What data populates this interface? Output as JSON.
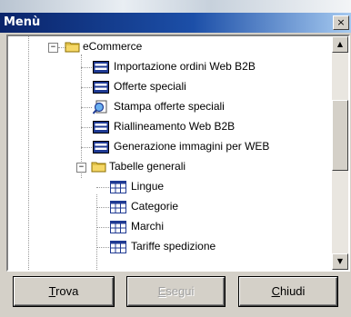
{
  "window": {
    "title": "Menù",
    "close_glyph": "×"
  },
  "tree": [
    {
      "label": "eCommerce",
      "icon": "folder-open-icon",
      "expander": "−"
    },
    {
      "label": "Importazione ordini Web B2B",
      "icon": "form-icon"
    },
    {
      "label": "Offerte speciali",
      "icon": "form-icon"
    },
    {
      "label": "Stampa offerte speciali",
      "icon": "print-preview-icon"
    },
    {
      "label": "Riallineamento Web B2B",
      "icon": "form-icon"
    },
    {
      "label": "Generazione immagini per WEB",
      "icon": "form-icon"
    },
    {
      "label": "Tabelle generali",
      "icon": "folder-open-icon",
      "expander": "−"
    },
    {
      "label": "Lingue",
      "icon": "table-icon"
    },
    {
      "label": "Categorie",
      "icon": "table-icon"
    },
    {
      "label": "Marchi",
      "icon": "table-icon"
    },
    {
      "label": "Tariffe spedizione",
      "icon": "table-icon"
    }
  ],
  "scrollbar": {
    "up_glyph": "▲",
    "down_glyph": "▼"
  },
  "buttons": {
    "find": {
      "mnemonic": "T",
      "rest": "rova",
      "enabled": true
    },
    "execute": {
      "mnemonic": "E",
      "rest": "segui",
      "enabled": false
    },
    "close": {
      "mnemonic": "C",
      "rest": "hiudi",
      "enabled": true
    }
  },
  "colors": {
    "title_start": "#0a246a",
    "title_end": "#a6caf0",
    "panel": "#d4d0c8",
    "folder": "#f5d766"
  }
}
